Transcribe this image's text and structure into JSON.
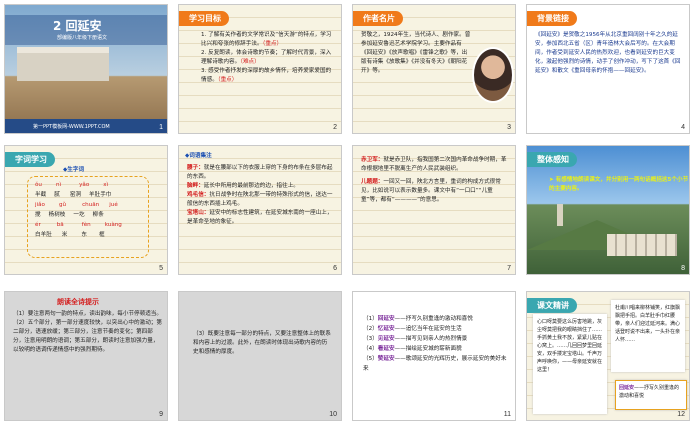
{
  "slides": [
    {
      "num": "1",
      "title": "2 回延安",
      "subtitle": "部编版八年级下册语文",
      "footer": "第一PPT模板网-WWW.1PPT.COM"
    },
    {
      "num": "2",
      "tag": "学习目标",
      "lines": [
        "1. 了解有关作者的文学常识及“信天游”的特点，学习比兴和夸张的修辞手法。",
        "（重点）",
        "2. 反复朗读，体会诗歌的节奏；了解时代背景，深入理解诗歌内容。",
        "（难点）",
        "3. 感受作者抒发的深厚的故乡情怀，培养爱家爱国的情感。",
        "（重点）"
      ]
    },
    {
      "num": "3",
      "tag": "作者名片",
      "text": "贺敬之，1924年生，当代诗人、剧作家。曾参加延安鲁迅艺术学院学习。主要作品有《回延安》《放声歌唱》《雷锋之歌》等，出版有诗集《放歌集》《并没有冬天》《朝阳花开》等。",
      "author": "贺敬之"
    },
    {
      "num": "4",
      "tag": "背景链接",
      "text": "《回延安》是贺敬之1956年从北京重回阔别十年之久的延安，参加西北五省（区）青年造林大会后写的。在大会期间，作者受到延安人民的热烈欢迎，也看到延安的巨大变化，激起他强烈的诗情，动手了创作冲动，写下了这首《回延安》和散文《重回母亲的怀抱——回延安》。"
    },
    {
      "num": "5",
      "tag": "字词学习",
      "heading": "◆生字词",
      "pinyin1": [
        "ǒu",
        "nì",
        "yǎo",
        "xì"
      ],
      "words1": [
        "半截",
        "腻",
        "窑洞",
        "羊肚手巾"
      ],
      "pinyin2": [
        "jiǎo",
        "gǔ",
        "chuān",
        "jué"
      ],
      "words2": [
        "搅",
        "杨树枝",
        "一圪",
        "柳条"
      ],
      "pinyin3": [
        "ér",
        "bā",
        "fèn",
        "kuàng"
      ],
      "words3": [
        "白羊肚",
        "米",
        "东",
        "框"
      ]
    },
    {
      "num": "6",
      "heading": "◆词语集注",
      "terms": [
        {
          "t": "腰子：",
          "d": "就是在腰部以下的衣服上穿的下身的布条在多层布起的东西。"
        },
        {
          "t": "脑畔：",
          "d": "延长中所用的最前那边的边，指往上。"
        },
        {
          "t": "鸡毛信：",
          "d": "抗日战争时在陕北那一带的特殊形式的信，送达一般信的东西插上鸡毛。"
        },
        {
          "t": "宝塔山：",
          "d": "延安中的标志性建筑，在延安城东南的一座山上，是革命圣地的象征。"
        }
      ]
    },
    {
      "num": "7",
      "terms": [
        {
          "t": "赤卫军：",
          "d": "就是赤卫队，指我国第二次国内革命战争时期，革命根据地里不脱离生产的人民武装组织。"
        },
        {
          "t": "儿题题：",
          "d": "一回又一回，陕北方言里，重词的构成方式很常见，比如说可以表示数量多。课文中有“一口口”“儿童童”等，都有“————”的意思。"
        }
      ]
    },
    {
      "num": "8",
      "tag": "整体感知",
      "bullet": "➤ 有感情地朗读课文，并分别用一两句话概括这5个小节的主要内容。"
    },
    {
      "num": "9",
      "heading": "朗读全诗提示",
      "text": "（1）要注意两句一韵的特点，读出韵味，每小节停顿适当。（2）五个部分，第一部分速度较快，以突出心中的激动；第二部分，语速放缓；第三部分，注意节奏的变化；第四部分，注意用明朗的语调；第五部分，朗读时注意加强力量，以较明的语调传递情感中的强烈期待。"
    },
    {
      "num": "10",
      "text": "（3）既要注意每一部分的特点，又要注意整体上的联系和内容上的过渡。此外，在朗读时体现出诗歌内容的历史和感情的厚度。"
    },
    {
      "num": "11",
      "items": [
        {
          "n": "（1）",
          "t": "回延安",
          "d": "——抒写久别重逢的激动和喜悦"
        },
        {
          "n": "（2）",
          "t": "忆延安",
          "d": "——追忆当年在延安的生活"
        },
        {
          "n": "（3）",
          "t": "见延安",
          "d": "——描写见到亲人的热烈情景"
        },
        {
          "n": "（4）",
          "t": "看延安",
          "d": "——描绘延安城的崭新面貌"
        },
        {
          "n": "（5）",
          "t": "赞延安",
          "d": "——歌颂延安的光辉历史，展示延安的美好未来"
        }
      ]
    },
    {
      "num": "12",
      "tag": "课文精讲",
      "left": "心口呀莫要这么厉害地跳，灰尘呀莫把我的眼睛挡住了……手抓黄土我不放，紧紧儿贴在心窝上。……几回回梦里回延安，双手搂定宝塔山。千声万声呼唤你，——母亲延安就在这里！",
      "right": "杜甫川唱来柳林铺笑，红旗飘飘把手招。白羊肚手巾红腰带，亲人们迎过延河来。满心话登时说不出来，一头扑在亲人怀……",
      "label": "回延安",
      "labeldesc": "——抒写久别重逢的激动和喜悦"
    }
  ]
}
